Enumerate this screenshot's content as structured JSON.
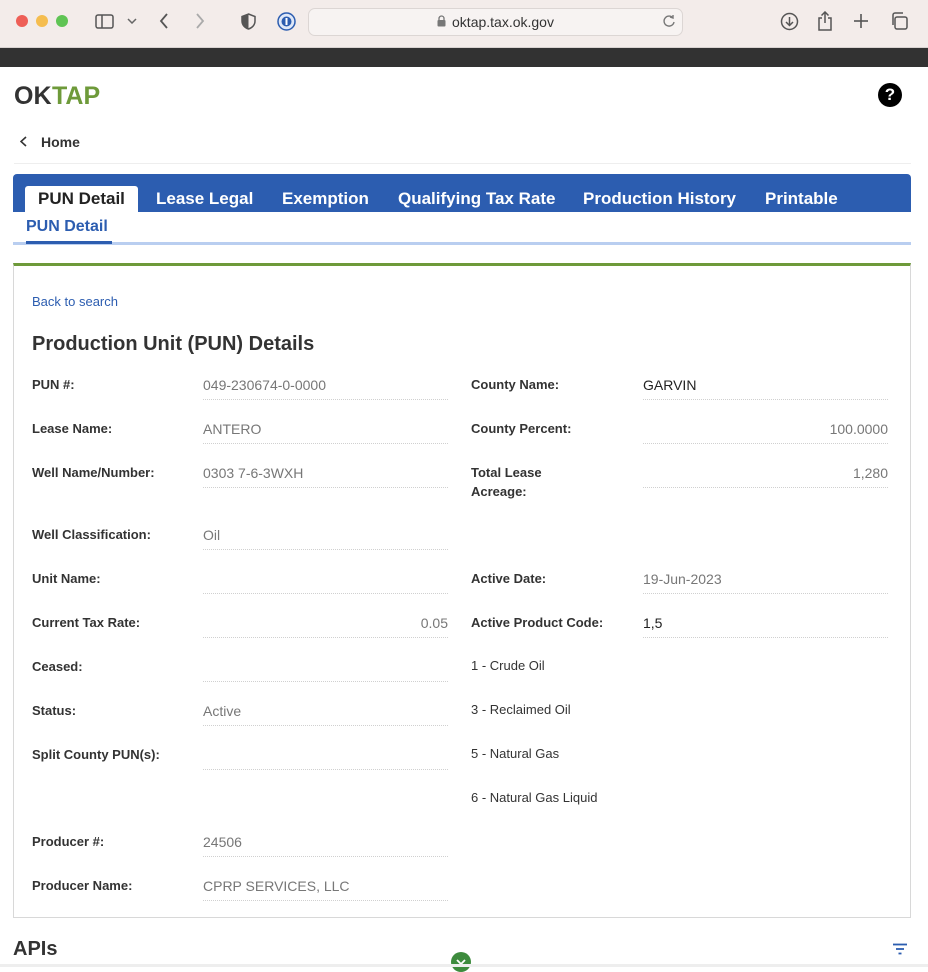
{
  "browser": {
    "url": "oktap.tax.ok.gov"
  },
  "header": {
    "logo_text": "OKTAP",
    "help_label": "?"
  },
  "breadcrumb": {
    "home_label": "Home"
  },
  "tabs": [
    {
      "label": "PUN Detail"
    },
    {
      "label": "Lease Legal"
    },
    {
      "label": "Exemption"
    },
    {
      "label": "Qualifying Tax Rate"
    },
    {
      "label": "Production History"
    },
    {
      "label": "Printable"
    }
  ],
  "subtab": {
    "label": "PUN Detail"
  },
  "card": {
    "back_link": "Back to search",
    "title": "Production Unit (PUN) Details",
    "left_fields": [
      {
        "label": "PUN #:",
        "value": "049-230674-0-0000"
      },
      {
        "label": "Lease Name:",
        "value": "ANTERO"
      },
      {
        "label": "Well Name/Number:",
        "value": "0303 7-6-3WXH"
      },
      {
        "label": "Well Classification:",
        "value": "Oil"
      },
      {
        "label": "Unit Name:",
        "value": ""
      },
      {
        "label": "Current Tax Rate:",
        "value": "0.05"
      },
      {
        "label": "Ceased:",
        "value": ""
      },
      {
        "label": "Status:",
        "value": "Active"
      },
      {
        "label": "Split County PUN(s):",
        "value": ""
      },
      {
        "label": "Producer #:",
        "value": "24506"
      },
      {
        "label": "Producer Name:",
        "value": "CPRP SERVICES, LLC"
      }
    ],
    "right_fields": [
      {
        "label": "County Name:",
        "value": "GARVIN"
      },
      {
        "label": "County Percent:",
        "value": "100.0000"
      },
      {
        "label": "Total Lease Acreage:",
        "value": "1,280"
      },
      {
        "label": "Active Date:",
        "value": "19-Jun-2023"
      },
      {
        "label": "Active Product Code:",
        "value": "1,5"
      }
    ],
    "product_codes": [
      "1 - Crude Oil",
      "3 - Reclaimed Oil",
      "5 - Natural Gas",
      "6 - Natural Gas Liquid"
    ]
  },
  "apis": {
    "title": "APIs"
  },
  "colors": {
    "primary": "#2c5db0",
    "accent_green": "#6e9a3a"
  }
}
